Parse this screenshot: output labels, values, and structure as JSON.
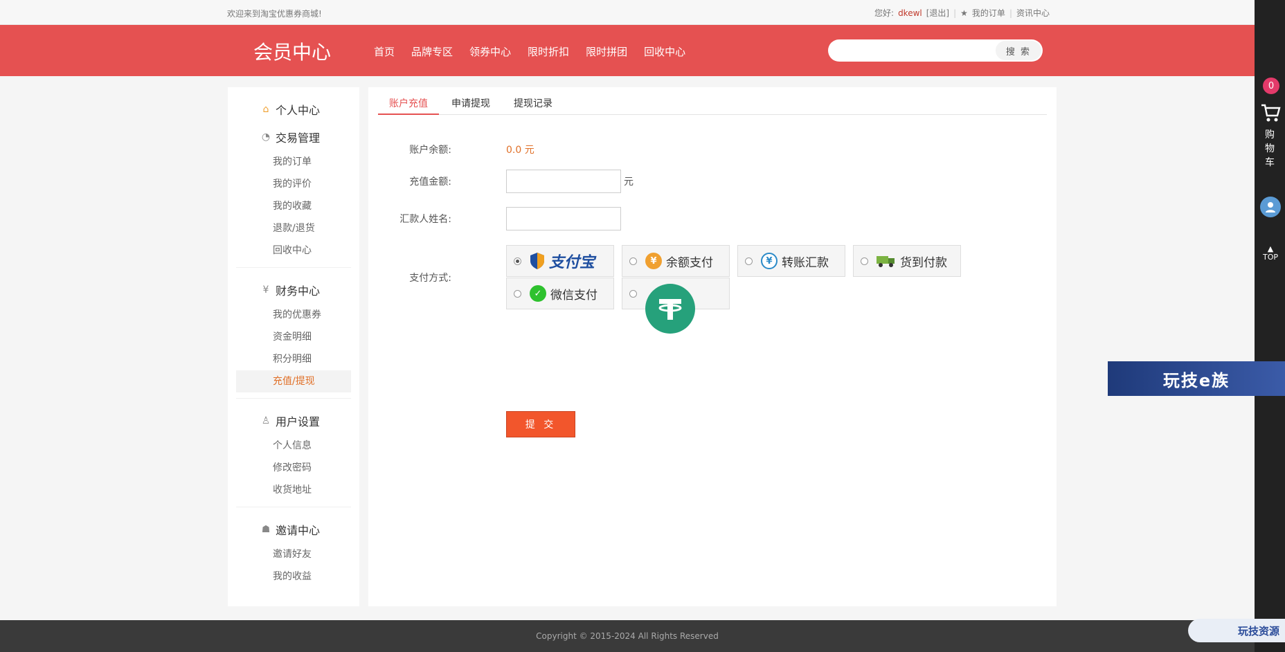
{
  "topbar": {
    "welcome": "欢迎来到淘宝优惠券商城!",
    "greeting": "您好:",
    "username": "dkewl",
    "logout": "[退出]",
    "my_orders": "我的订单",
    "news": "资讯中心"
  },
  "header": {
    "title": "会员中心",
    "nav": [
      "首页",
      "品牌专区",
      "领券中心",
      "限时折扣",
      "限时拼团",
      "回收中心"
    ],
    "search_placeholder": "",
    "search_button": "搜 索"
  },
  "sidebar": {
    "personal_center": "个人中心",
    "groups": [
      {
        "title": "交易管理",
        "icon": "trade-icon",
        "items": [
          "我的订单",
          "我的评价",
          "我的收藏",
          "退款/退货",
          "回收中心"
        ]
      },
      {
        "title": "财务中心",
        "icon": "finance-icon",
        "items": [
          "我的优惠券",
          "资金明细",
          "积分明细",
          "充值/提现"
        ]
      },
      {
        "title": "用户设置",
        "icon": "user-settings-icon",
        "items": [
          "个人信息",
          "修改密码",
          "收货地址"
        ]
      },
      {
        "title": "邀请中心",
        "icon": "invite-icon",
        "items": [
          "邀请好友",
          "我的收益"
        ]
      }
    ],
    "active_item": "充值/提现"
  },
  "tabs": [
    "账户充值",
    "申请提现",
    "提现记录"
  ],
  "active_tab": "账户充值",
  "form": {
    "balance_label": "账户余额:",
    "balance_value": "0.0 元",
    "amount_label": "充值金额:",
    "amount_value": "",
    "amount_unit": "元",
    "name_label": "汇款人姓名:",
    "name_value": "",
    "pay_label": "支付方式:",
    "pay_methods": [
      {
        "name": "支付宝",
        "icon": "alipay-icon",
        "selected": true
      },
      {
        "name": "余额支付",
        "icon": "balance-pay-icon",
        "selected": false
      },
      {
        "name": "转账汇款",
        "icon": "transfer-icon",
        "selected": false
      },
      {
        "name": "货到付款",
        "icon": "cod-icon",
        "selected": false
      },
      {
        "name": "微信支付",
        "icon": "wechat-pay-icon",
        "selected": false
      },
      {
        "name": "",
        "icon": "usdt-icon",
        "selected": false
      }
    ],
    "submit": "提 交"
  },
  "footer": {
    "copyright": "Copyright © 2015-2024 All Rights Reserved"
  },
  "rightbar": {
    "cart_count": "0",
    "cart_label": "购物车",
    "top_label": "TOP"
  },
  "banner": "玩技e族",
  "watermark": "玩技资源"
}
